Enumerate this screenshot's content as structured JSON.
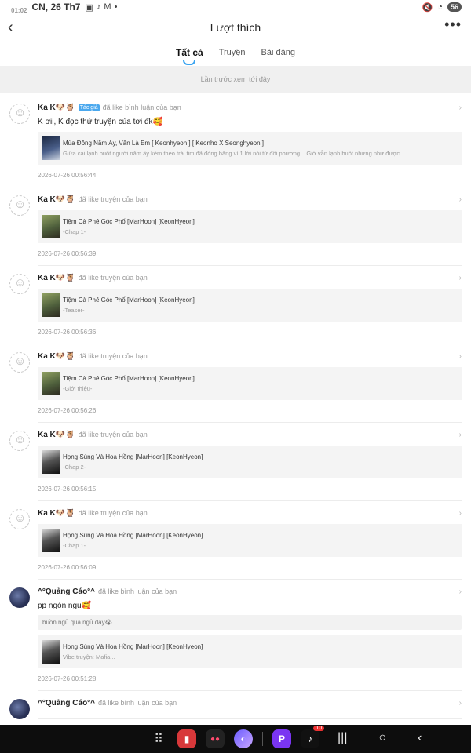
{
  "status": {
    "time": "01:02",
    "date": "CN, 26 Th7",
    "battery": "56"
  },
  "header": {
    "title": "Lượt thích"
  },
  "tabs": [
    {
      "label": "Tất cả"
    },
    {
      "label": "Truyện"
    },
    {
      "label": "Bài đăng"
    }
  ],
  "seen_banner": "Lần trước xem tới đây",
  "items": [
    {
      "name": "Ka K🐶🦉",
      "badge": "Tác giả",
      "action": "đã like bình luận của bạn",
      "comment": "K ơii, K đọc thử truyện của tơi đk🥰",
      "card_title": "Mùa Đông Năm Ấy, Vẫn Là Em [ Keonhyeon ] [ Keonho X Seonghyeon ]",
      "card_sub": "Giữa cái lạnh buốt người năm ấy kèm theo trái tim đã đóng băng vì 1 lời nói từ đối phương... Giờ vẫn lạnh buốt nhưng như được...",
      "time": "2026-07-26 00:56:44"
    },
    {
      "name": "Ka K🐶🦉",
      "action": "đã like truyện của bạn",
      "card_title": "Tiệm Cà Phê Góc Phố [MarHoon] [KeonHyeon]",
      "card_sub": "-Chap 1-",
      "time": "2026-07-26 00:56:39"
    },
    {
      "name": "Ka K🐶🦉",
      "action": "đã like truyện của bạn",
      "card_title": "Tiệm Cà Phê Góc Phố [MarHoon] [KeonHyeon]",
      "card_sub": "-Teaser-",
      "time": "2026-07-26 00:56:36"
    },
    {
      "name": "Ka K🐶🦉",
      "action": "đã like truyện của bạn",
      "card_title": "Tiệm Cà Phê Góc Phố [MarHoon] [KeonHyeon]",
      "card_sub": "-Giới thiệu-",
      "time": "2026-07-26 00:56:26"
    },
    {
      "name": "Ka K🐶🦉",
      "action": "đã like truyện của bạn",
      "card_title": "Họng Súng Và Hoa Hồng [MarHoon] [KeonHyeon]",
      "card_sub": "-Chap 2-",
      "time": "2026-07-26 00:56:15"
    },
    {
      "name": "Ka K🐶🦉",
      "action": "đã like truyện của bạn",
      "card_title": "Họng Súng Và Hoa Hồng [MarHoon] [KeonHyeon]",
      "card_sub": "-Chap 1-",
      "time": "2026-07-26 00:56:09"
    },
    {
      "name": "^°Quảng Cáo°^",
      "action": "đã like bình luận của bạn",
      "comment": "pp ngỏn ngu🥰",
      "quote": "buồn ngủ quá ngủ đay😭",
      "card_title": "Họng Súng Và Hoa Hồng [MarHoon] [KeonHyeon]",
      "card_sub": "Vibe truyện: Mafia...",
      "time": "2026-07-26 00:51:28"
    },
    {
      "name": "^°Quảng Cáo°^",
      "action": "đã like bình luận của bạn"
    }
  ],
  "navbar": {
    "tiktok_badge": "10"
  },
  "colors": {
    "accent": "#3aa4f0",
    "badge": "#4aa8ee",
    "banner_bg": "#f0f0f0",
    "card_bg": "#f4f4f4"
  }
}
